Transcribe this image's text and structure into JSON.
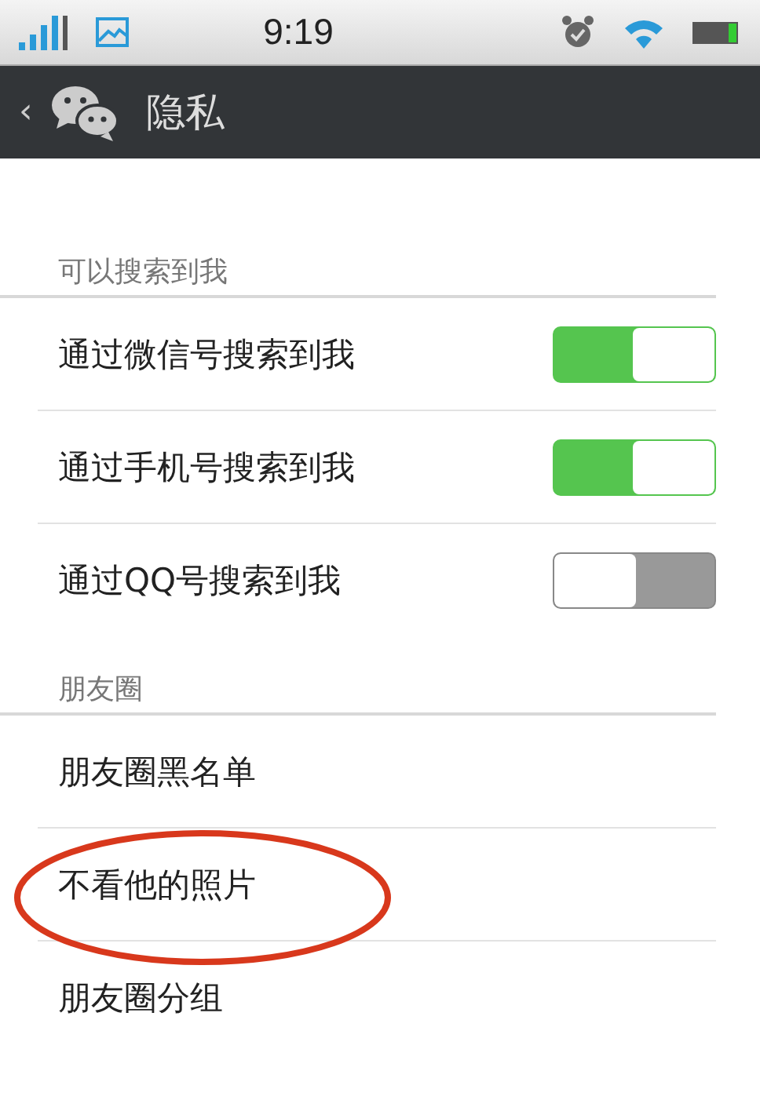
{
  "status_bar": {
    "time": "9:19"
  },
  "header": {
    "back": "‹",
    "title": "隐私"
  },
  "sections": [
    {
      "header": "可以搜索到我",
      "items": [
        {
          "kind": "toggle",
          "label": "通过微信号搜索到我",
          "on": true
        },
        {
          "kind": "toggle",
          "label": "通过手机号搜索到我",
          "on": true
        },
        {
          "kind": "toggle",
          "label": "通过QQ号搜索到我",
          "on": false
        }
      ]
    },
    {
      "header": "朋友圈",
      "items": [
        {
          "kind": "link",
          "label": "朋友圈黑名单"
        },
        {
          "kind": "link",
          "label": "不看他的照片"
        },
        {
          "kind": "link",
          "label": "朋友圈分组"
        }
      ]
    }
  ],
  "annotation": {
    "kind": "ellipse"
  }
}
